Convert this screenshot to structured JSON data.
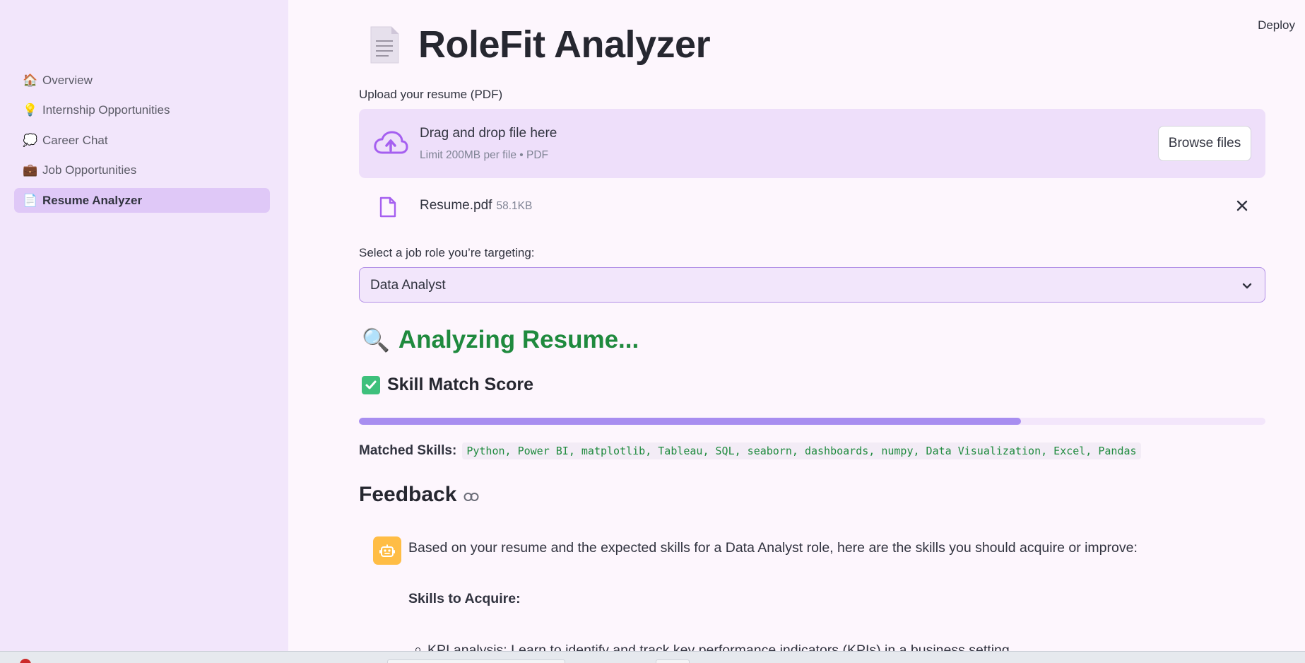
{
  "sidebar": {
    "items": [
      {
        "icon": "🏠",
        "icon_name": "house-icon",
        "label": "Overview",
        "active": false
      },
      {
        "icon": "💡",
        "icon_name": "lightbulb-icon",
        "label": "Internship Opportunities",
        "active": false
      },
      {
        "icon": "💭",
        "icon_name": "speech-bubble-icon",
        "label": "Career Chat",
        "active": false
      },
      {
        "icon": "💼",
        "icon_name": "briefcase-icon",
        "label": "Job Opportunities",
        "active": false
      },
      {
        "icon": "📄",
        "icon_name": "document-icon",
        "label": "Resume Analyzer",
        "active": true
      }
    ]
  },
  "header": {
    "deploy_label": "Deploy",
    "title": "RoleFit Analyzer",
    "title_icon": "document-icon"
  },
  "upload": {
    "label": "Upload your resume (PDF)",
    "drag_text": "Drag and drop file here",
    "limit_text": "Limit 200MB per file • PDF",
    "browse_label": "Browse files",
    "file": {
      "name": "Resume.pdf",
      "size": "58.1KB"
    }
  },
  "role_select": {
    "label": "Select a job role you’re targeting:",
    "value": "Data Analyst"
  },
  "analysis": {
    "heading_icon": "🔍",
    "heading": "Analyzing Resume...",
    "score_heading": "Skill Match Score",
    "score_fraction": 0.73,
    "matched_label": "Matched Skills:",
    "matched_skills": "Python, Power BI, matplotlib, Tableau, SQL, seaborn, dashboards, numpy, Data Visualization, Excel, Pandas"
  },
  "feedback": {
    "heading": "Feedback",
    "message": "Based on your resume and the expected skills for a Data Analyst role, here are the skills you should acquire or improve:",
    "skills_heading": "Skills to Acquire:",
    "first_item": "KPI analysis: Learn to identify and track key performance indicators (KPIs) in a business setting."
  },
  "colors": {
    "sidebar_bg": "#f2e6fb",
    "main_bg": "#fdf6fd",
    "accent": "#a88ef0",
    "success": "#1f8a3e",
    "avatar": "#ffbd45"
  }
}
